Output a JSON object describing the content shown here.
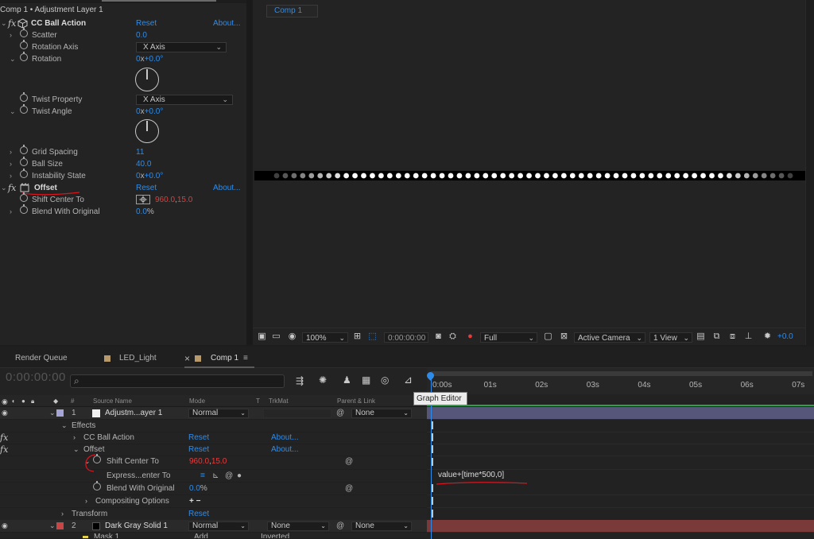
{
  "effect_controls": {
    "header": "Comp 1 • Adjustment Layer 1",
    "effect1": {
      "name": "CC Ball Action",
      "reset": "Reset",
      "about": "About...",
      "props": {
        "scatter_label": "Scatter",
        "scatter_value": "0.0",
        "rotation_axis_label": "Rotation Axis",
        "rotation_axis_value": "X Axis",
        "rotation_label": "Rotation",
        "rotation_value_rev": "0",
        "rotation_value_x": "x",
        "rotation_value_deg": "+0.0",
        "rotation_unit": "°",
        "twist_property_label": "Twist Property",
        "twist_property_value": "X Axis",
        "twist_angle_label": "Twist Angle",
        "twist_angle_rev": "0",
        "twist_angle_x": "x",
        "twist_angle_deg": "+0.0",
        "twist_angle_unit": "°",
        "grid_spacing_label": "Grid Spacing",
        "grid_spacing_value": "11",
        "ball_size_label": "Ball Size",
        "ball_size_value": "40.0",
        "instability_label": "Instability State",
        "instability_rev": "0",
        "instability_x": "x",
        "instability_deg": "+0.0",
        "instability_unit": "°"
      }
    },
    "effect2": {
      "name": "Offset",
      "reset": "Reset",
      "about": "About...",
      "props": {
        "shift_center_label": "Shift Center To",
        "shift_center_x": "960.0",
        "shift_center_comma": ",",
        "shift_center_y": "15.0",
        "blend_label": "Blend With Original",
        "blend_value": "0.0",
        "blend_unit": "%"
      }
    },
    "fx_glyph": "fx"
  },
  "viewer": {
    "comp_tab": "Comp 1",
    "balls": 60,
    "toolbar": {
      "zoom": "100%",
      "timecode": "0:00:00:00",
      "resolution": "Full",
      "camera": "Active Camera",
      "views": "1 View",
      "exposure": "+0.0"
    }
  },
  "timeline": {
    "tabs": {
      "render_queue": "Render Queue",
      "led_light": "LED_Light",
      "comp1": "Comp 1",
      "close": "×",
      "menu": "≡"
    },
    "timecode": "0:00:00:00",
    "search_icon": "⌕",
    "columns": {
      "num": "#",
      "source": "Source Name",
      "mode": "Mode",
      "t": "T",
      "trkmat": "TrkMat",
      "parent": "Parent & Link"
    },
    "layers": {
      "l1_num": "1",
      "l1_name": "Adjustm...ayer 1",
      "l1_mode": "Normal",
      "l1_parent": "None",
      "effects_label": "Effects",
      "ccball_label": "CC Ball Action",
      "ccball_reset": "Reset",
      "ccball_about": "About...",
      "offset_label": "Offset",
      "offset_reset": "Reset",
      "offset_about": "About...",
      "shift_label": "Shift Center To",
      "shift_x": "960.0",
      "shift_comma": ",",
      "shift_y": "15.0",
      "expr_label": "Express...enter To",
      "blend_label": "Blend With Original",
      "blend_value": "0.0",
      "blend_unit": "%",
      "compositing_label": "Compositing Options",
      "compositing_controls": "+ −",
      "transform_label": "Transform",
      "transform_reset": "Reset",
      "l2_num": "2",
      "l2_name": "Dark Gray Solid 1",
      "l2_mode": "Normal",
      "l2_trkmat": "None",
      "l2_parent": "None",
      "mask_label": "Mask 1",
      "mask_mode": "Add",
      "mask_inverted": "Inverted"
    },
    "ruler": [
      "0:00s",
      "01s",
      "02s",
      "03s",
      "04s",
      "05s",
      "06s",
      "07s"
    ],
    "expression_text": "value+[time*500,0]",
    "tooltip": "Graph Editor"
  },
  "colors": {
    "accent_blue": "#2d8ceb",
    "value_red": "#e43c3c",
    "annotation_red": "#d9141e",
    "layer1_label": "#a4a4d6",
    "layer2_label": "#c84646",
    "layer1_bar": "#5c5c82",
    "layer2_bar": "#7a3a3a"
  }
}
